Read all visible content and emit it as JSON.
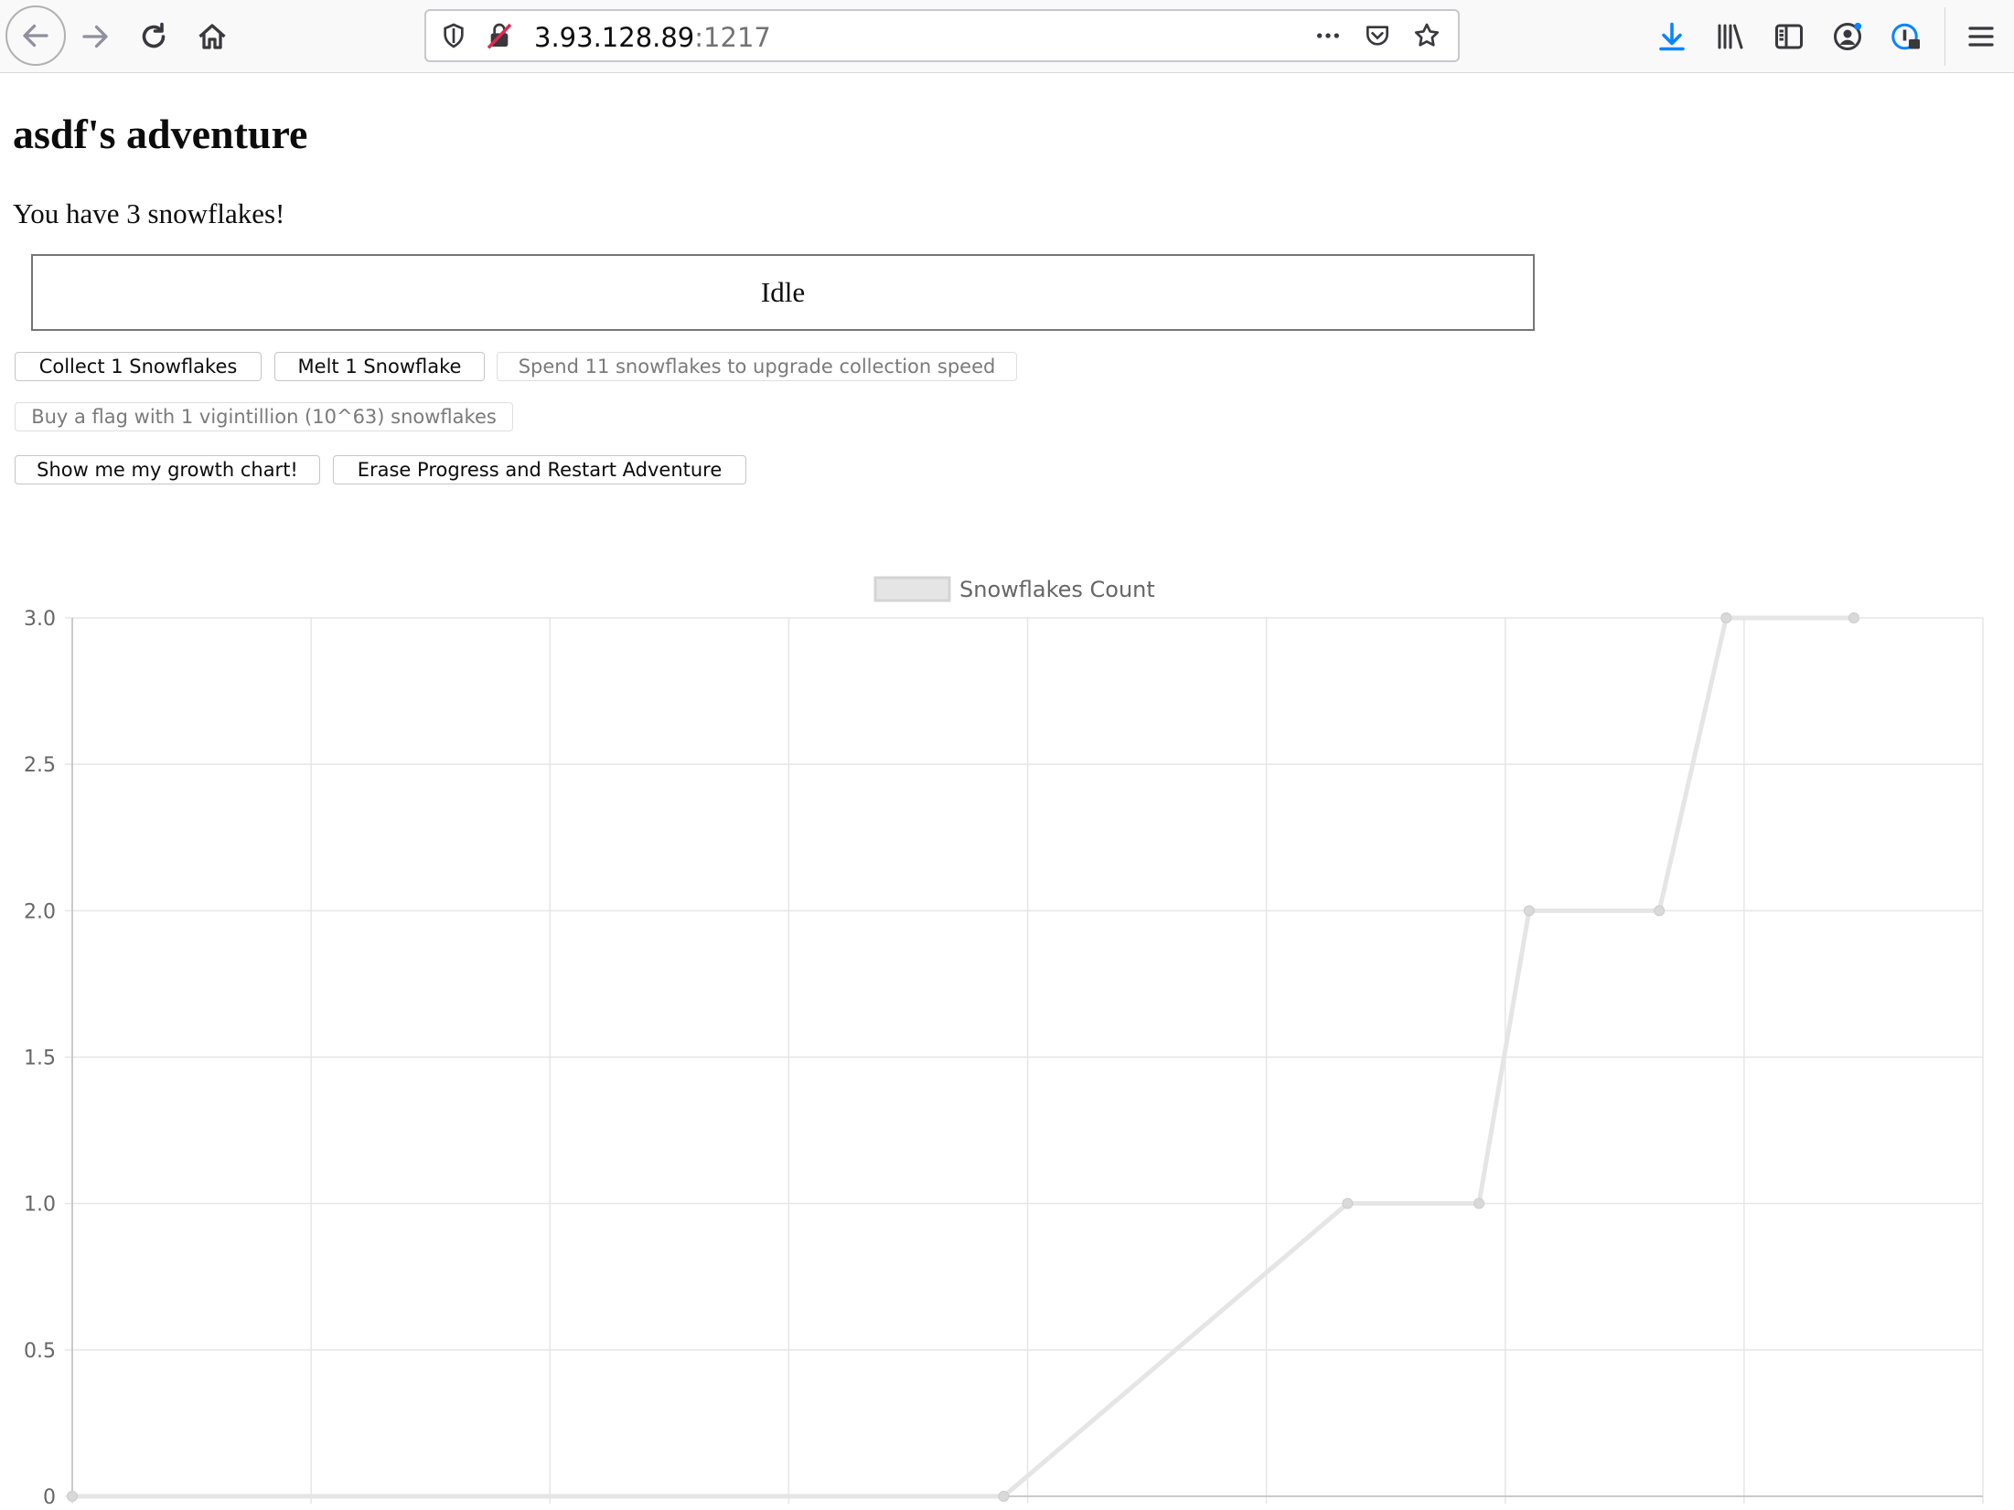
{
  "browser": {
    "url_host": "3.93.128.89",
    "url_port": ":1217"
  },
  "page": {
    "title": "asdf's adventure",
    "count_text": "You have 3 snowflakes!",
    "status": "Idle",
    "buttons": {
      "collect": "Collect 1 Snowflakes",
      "melt": "Melt 1 Snowflake",
      "upgrade": "Spend 11 snowflakes to upgrade collection speed",
      "buy_flag": "Buy a flag with 1 vigintillion (10^63) snowflakes",
      "show_chart": "Show me my growth chart!",
      "erase": "Erase Progress and Restart Adventure"
    }
  },
  "chart_data": {
    "type": "line",
    "series": [
      {
        "name": "Snowflakes Count",
        "x": [
          0,
          7.8,
          10.68,
          11.78,
          12.2,
          13.29,
          13.85,
          14.92
        ],
        "y": [
          0,
          0,
          1,
          1,
          2,
          2,
          3,
          3
        ]
      }
    ],
    "xlim": [
      0,
      16
    ],
    "ylim": [
      0,
      3
    ],
    "xticks": [
      "0",
      "2",
      "4",
      "6",
      "8",
      "10",
      "12",
      "14",
      "16"
    ],
    "yticks": [
      "0",
      "0.5",
      "1.0",
      "1.5",
      "2.0",
      "2.5",
      "3.0"
    ],
    "grid": true,
    "legend": "top-center",
    "line_color": "#e5e5e5",
    "point_color": "#d9d9d9"
  }
}
